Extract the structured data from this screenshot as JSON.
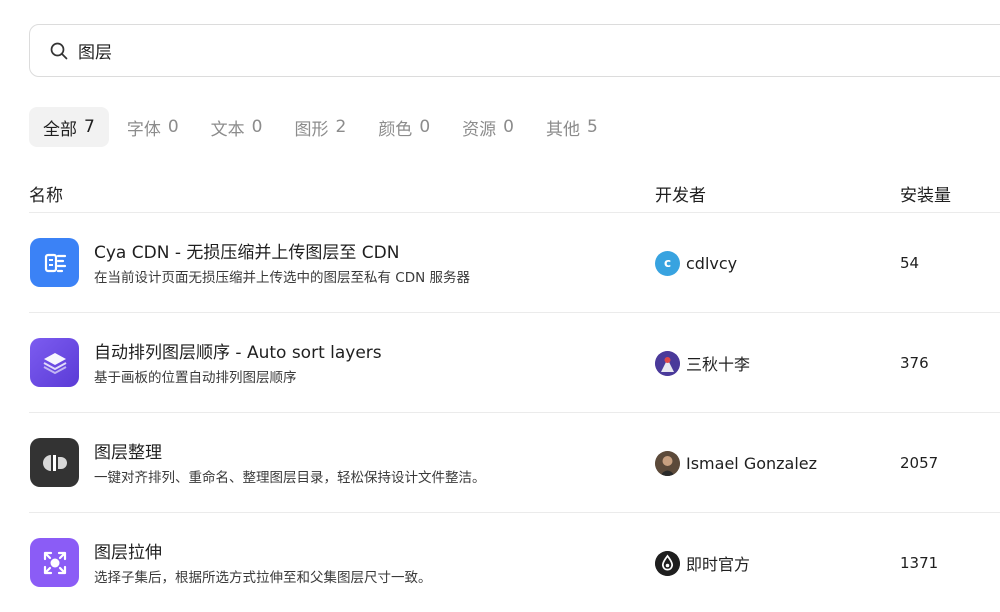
{
  "search": {
    "value": "图层",
    "icon": "search-icon"
  },
  "tabs": [
    {
      "label": "全部",
      "count": "7",
      "active": true
    },
    {
      "label": "字体",
      "count": "0",
      "active": false
    },
    {
      "label": "文本",
      "count": "0",
      "active": false
    },
    {
      "label": "图形",
      "count": "2",
      "active": false
    },
    {
      "label": "颜色",
      "count": "0",
      "active": false
    },
    {
      "label": "资源",
      "count": "0",
      "active": false
    },
    {
      "label": "其他",
      "count": "5",
      "active": false
    }
  ],
  "table": {
    "headers": {
      "name": "名称",
      "developer": "开发者",
      "installs": "安装量"
    },
    "rows": [
      {
        "title": "Cya CDN - 无损压缩并上传图层至 CDN",
        "description": "在当前设计页面无损压缩并上传选中的图层至私有 CDN 服务器",
        "icon": "cdn-upload-icon",
        "icon_color": "#3b82f6",
        "developer": "cdlvcy",
        "avatar_letter": "c",
        "avatar_color": "#38a3e0",
        "installs": "54"
      },
      {
        "title": "自动排列图层顺序 - Auto sort layers",
        "description": "基于画板的位置自动排列图层顺序",
        "icon": "layers-stack-icon",
        "icon_color": "#6d4ce8",
        "developer": "三秋十李",
        "installs": "376"
      },
      {
        "title": "图层整理",
        "description": "一键对齐排列、重命名、整理图层目录，轻松保持设计文件整洁。",
        "icon": "align-layers-icon",
        "icon_color": "#333333",
        "developer": "Ismael Gonzalez",
        "installs": "2057"
      },
      {
        "title": "图层拉伸",
        "description": "选择子集后，根据所选方式拉伸至和父集图层尺寸一致。",
        "icon": "stretch-icon",
        "icon_color": "#8b5cf6",
        "developer": "即时官方",
        "installs": "1371"
      }
    ]
  }
}
